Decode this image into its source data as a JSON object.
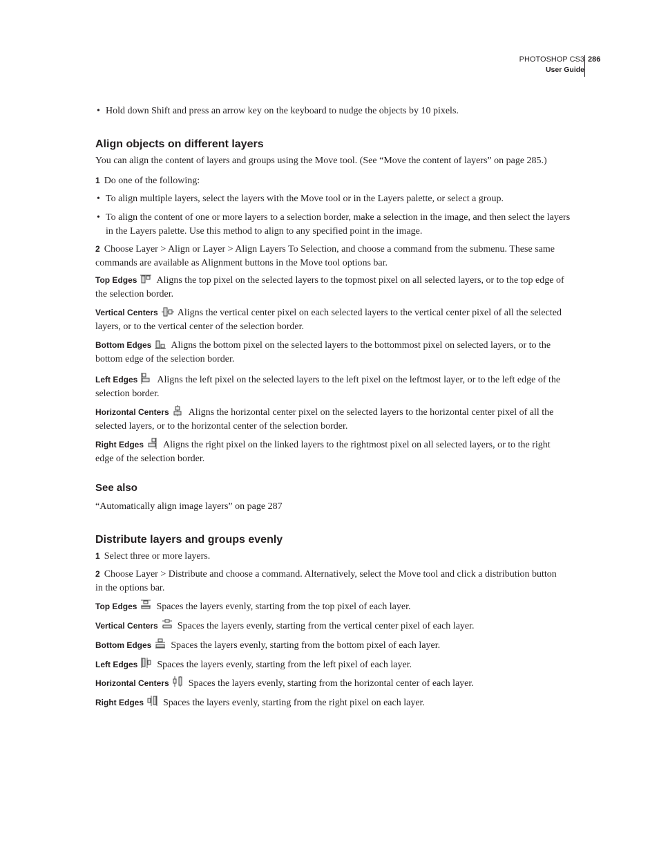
{
  "header": {
    "product": "PHOTOSHOP CS3",
    "guide": "User Guide",
    "page_number": "286"
  },
  "top_bullet": "Hold down Shift and press an arrow key on the keyboard to nudge the objects by 10 pixels.",
  "align_section": {
    "heading": "Align objects on different layers",
    "intro": "You can align the content of layers and groups using the Move tool. (See “Move the content of layers” on page 285.)",
    "step1_num": "1",
    "step1": "Do one of the following:",
    "bullets": [
      "To align multiple layers, select the layers with the Move tool or in the Layers palette, or select a group.",
      "To align the content of one or more layers to a selection border, make a selection in the image, and then select the layers in the Layers palette. Use this method to align to any specified point in the image."
    ],
    "step2_num": "2",
    "step2": "Choose Layer > Align or Layer > Align Layers To Selection, and choose a command from the submenu. These same commands are available as Alignment buttons in the Move tool options bar.",
    "options": [
      {
        "term": "Top Edges",
        "icon": "align-top-edges-icon",
        "text": "Aligns the top pixel on the selected layers to the topmost pixel on all selected layers, or to the top edge of the selection border."
      },
      {
        "term": "Vertical Centers",
        "icon": "align-vertical-centers-icon",
        "text": "Aligns the vertical center pixel on each selected layers to the vertical center pixel of all the selected layers, or to the vertical center of the selection border."
      },
      {
        "term": "Bottom Edges",
        "icon": "align-bottom-edges-icon",
        "text": "Aligns the bottom pixel on the selected layers to the bottommost pixel on selected layers, or to the bottom edge of the selection border."
      },
      {
        "term": "Left Edges",
        "icon": "align-left-edges-icon",
        "text": "Aligns the left pixel on the selected layers to the left pixel on the leftmost layer, or to the left edge of the selection border."
      },
      {
        "term": "Horizontal Centers",
        "icon": "align-horizontal-centers-icon",
        "text": "Aligns the horizontal center pixel on the selected layers to the horizontal center pixel of all the selected layers, or to the horizontal center of the selection border."
      },
      {
        "term": "Right Edges",
        "icon": "align-right-edges-icon",
        "text": "Aligns the right pixel on the linked layers to the rightmost pixel on all selected layers, or to the right edge of the selection border."
      }
    ]
  },
  "see_also": {
    "heading": "See also",
    "link": "“Automatically align image layers” on page 287"
  },
  "distribute_section": {
    "heading": "Distribute layers and groups evenly",
    "step1_num": "1",
    "step1": "Select three or more layers.",
    "step2_num": "2",
    "step2": "Choose Layer > Distribute and choose a command. Alternatively, select the Move tool and click a distribution button in the options bar.",
    "options": [
      {
        "term": "Top Edges",
        "icon": "distribute-top-edges-icon",
        "text": "Spaces the layers evenly, starting from the top pixel of each layer."
      },
      {
        "term": "Vertical Centers",
        "icon": "distribute-vertical-centers-icon",
        "text": "Spaces the layers evenly, starting from the vertical center pixel of each layer."
      },
      {
        "term": "Bottom Edges",
        "icon": "distribute-bottom-edges-icon",
        "text": "Spaces the layers evenly, starting from the bottom pixel of each layer."
      },
      {
        "term": "Left Edges",
        "icon": "distribute-left-edges-icon",
        "text": "Spaces the layers evenly, starting from the left pixel of each layer."
      },
      {
        "term": "Horizontal Centers",
        "icon": "distribute-horizontal-centers-icon",
        "text": "Spaces the layers evenly, starting from the horizontal center of each layer."
      },
      {
        "term": "Right Edges",
        "icon": "distribute-right-edges-icon",
        "text": "Spaces the layers evenly, starting from the right pixel on each layer."
      }
    ]
  }
}
